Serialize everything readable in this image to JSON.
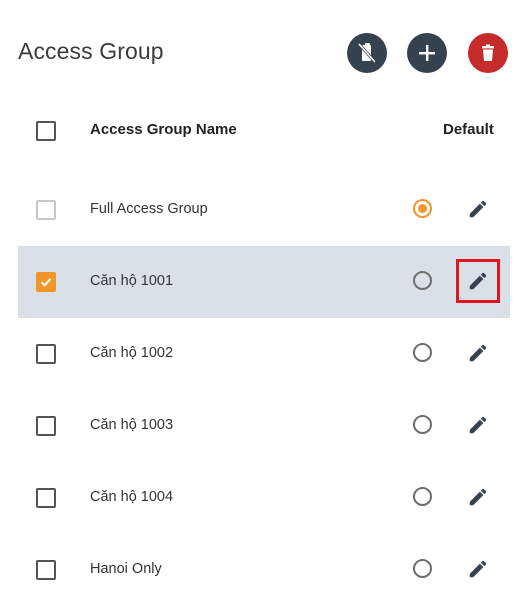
{
  "page": {
    "title": "Access Group"
  },
  "toolbar": {
    "unlink_icon": "no-link-icon",
    "add_icon": "plus-icon",
    "delete_icon": "trash-icon",
    "colors": {
      "fab_dark": "#36424f",
      "fab_delete": "#c62b2b",
      "icon": "#ffffff"
    }
  },
  "table": {
    "columns": {
      "name": "Access Group Name",
      "default": "Default"
    },
    "rows": [
      {
        "name": "Full Access Group",
        "checked": false,
        "checkbox_disabled": true,
        "is_default": true,
        "selected": false
      },
      {
        "name": "Căn hộ 1001",
        "checked": true,
        "checkbox_disabled": false,
        "is_default": false,
        "selected": true
      },
      {
        "name": "Căn hộ 1002",
        "checked": false,
        "checkbox_disabled": false,
        "is_default": false,
        "selected": false
      },
      {
        "name": "Căn hộ 1003",
        "checked": false,
        "checkbox_disabled": false,
        "is_default": false,
        "selected": false
      },
      {
        "name": "Căn hộ 1004",
        "checked": false,
        "checkbox_disabled": false,
        "is_default": false,
        "selected": false
      },
      {
        "name": "Hanoi Only",
        "checked": false,
        "checkbox_disabled": false,
        "is_default": false,
        "selected": false
      }
    ]
  },
  "colors": {
    "accent": "#f0962a",
    "selected_row": "#d9e0e8",
    "highlight_outline": "#e2141d",
    "edit_icon": "#36424f"
  }
}
